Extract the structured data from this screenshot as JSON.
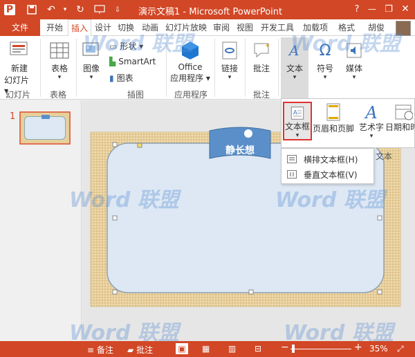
{
  "window": {
    "title": "演示文稿1 - Microsoft PowerPoint",
    "logo_letter": "P",
    "help": "?",
    "min": "—",
    "restore": "❐",
    "close": "✕"
  },
  "tabs": [
    "文件",
    "开始",
    "插入",
    "设计",
    "切换",
    "动画",
    "幻灯片放映",
    "审阅",
    "视图",
    "开发工具",
    "加载项",
    "格式",
    "胡俊"
  ],
  "ribbon": {
    "new_slide": "新建\n幻灯片",
    "new_slide_l1": "新建",
    "new_slide_l2": "幻灯片 ▾",
    "table": "表格",
    "table_arrow": "▾",
    "image": "图像",
    "image_arrow": "▾",
    "shapes": "形状 ▾",
    "smartart": "SmartArt",
    "chart": "图表",
    "office_apps_l1": "Office",
    "office_apps_l2": "应用程序 ▾",
    "link": "链接",
    "link_arrow": "▾",
    "comment": "批注",
    "text": "文本",
    "text_arrow": "▾",
    "symbol": "符号",
    "symbol_arrow": "▾",
    "media": "媒体",
    "media_arrow": "▾",
    "groups": {
      "slides": "幻灯片",
      "tables": "表格",
      "illustrations": "插图",
      "apps": "应用程序",
      "comments": "批注"
    }
  },
  "text_dropdown": {
    "textbox": "文本框",
    "textbox_arrow": "▾",
    "header_footer": "页眉和页脚",
    "wordart": "艺术字",
    "wordart_arrow": "▾",
    "datetime": "日期和时",
    "group_label": "文本",
    "menu": {
      "horizontal": "横排文本框(H)",
      "vertical": "垂直文本框(V)"
    }
  },
  "slide_pane": {
    "slide_number": "1"
  },
  "slide": {
    "banner_text": "静长想"
  },
  "statusbar": {
    "notes": "备注",
    "comments": "批注",
    "zoom": "35%",
    "zoom_minus": "−",
    "zoom_plus": "+"
  },
  "watermark": {
    "text": "Word 联盟"
  },
  "colors": {
    "accent": "#d24726",
    "slide_fill": "#dde8f4",
    "slide_border_texture": "#e7cf9c",
    "banner": "#5b8fc9"
  }
}
